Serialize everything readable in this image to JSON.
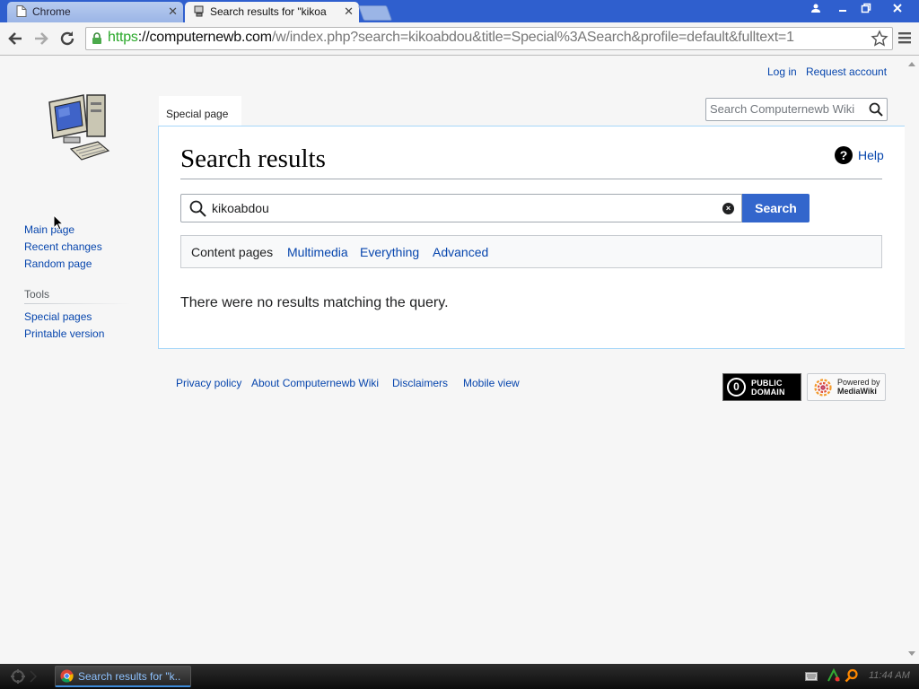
{
  "browser": {
    "tabs": [
      {
        "title": "Chrome",
        "active": false
      },
      {
        "title": "Search results for \"kikoa",
        "active": true
      }
    ],
    "url": {
      "scheme": "https",
      "host": "://computernewb.com",
      "path": "/w/index.php?search=kikoabdou&title=Special%3ASearch&profile=default&fulltext=1"
    }
  },
  "wiki": {
    "personal": {
      "login": "Log in",
      "request_account": "Request account"
    },
    "tab_special": "Special page",
    "search_placeholder": "Search Computernewb Wiki",
    "sidebar": {
      "main_page": "Main page",
      "recent_changes": "Recent changes",
      "random_page": "Random page",
      "tools_heading": "Tools",
      "special_pages": "Special pages",
      "printable_version": "Printable version"
    },
    "heading": "Search results",
    "help": "Help",
    "query": "kikoabdou",
    "search_button": "Search",
    "profiles": [
      "Content pages",
      "Multimedia",
      "Everything",
      "Advanced"
    ],
    "selected_profile": "Content pages",
    "no_results": "There were no results matching the query.",
    "footer": {
      "privacy": "Privacy policy",
      "about": "About Computernewb Wiki",
      "disclaimers": "Disclaimers",
      "mobile": "Mobile view"
    },
    "badges": {
      "pd_line1": "PUBLIC",
      "pd_line2": "DOMAIN",
      "mw_line1": "Powered by",
      "mw_line2": "MediaWiki"
    }
  },
  "taskbar": {
    "item": "Search results for \"k..",
    "clock": "11:44 AM"
  },
  "colors": {
    "link": "#0645ad",
    "button": "#3366cc",
    "tabstrip": "#2f5fce"
  }
}
